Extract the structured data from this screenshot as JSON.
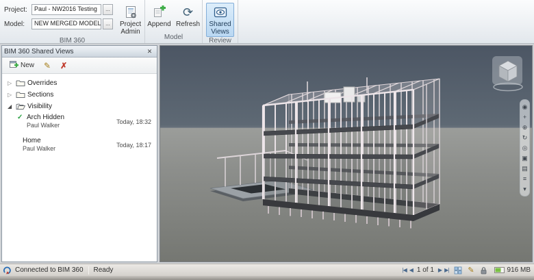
{
  "ribbon": {
    "project": {
      "label": "Project:",
      "value": "Paul - NW2016 Testing"
    },
    "model": {
      "label": "Model:",
      "value": "NEW MERGED MODEL"
    },
    "browse": "...",
    "project_admin": {
      "line1": "Project",
      "line2": "Admin"
    },
    "append_label": "Append",
    "refresh_label": "Refresh",
    "shared_views": {
      "line1": "Shared",
      "line2": "Views"
    },
    "groups": {
      "bim360": "BIM 360",
      "model": "Model",
      "review": "Review"
    }
  },
  "panel": {
    "title": "BIM 360 Shared Views",
    "toolbar": {
      "new_label": "New"
    },
    "tree": {
      "overrides": "Overrides",
      "sections": "Sections",
      "visibility": "Visibility",
      "arch_hidden": {
        "label": "Arch Hidden",
        "author": "Paul Walker",
        "time": "Today, 18:32"
      },
      "home": {
        "label": "Home",
        "author": "Paul Walker",
        "time": "Today, 18:17"
      }
    }
  },
  "statusbar": {
    "connected": "Connected to BIM 360",
    "ready": "Ready",
    "page": "1 of 1",
    "memory": "916 MB"
  },
  "icons": {
    "close": "✕",
    "delete_x": "✗",
    "edit_pencil": "✎",
    "check": "✓",
    "refresh": "⟳",
    "collapsed": "▷",
    "expanded": "◢",
    "first": "|◀",
    "prev": "◀",
    "next": "▶",
    "last": "▶|",
    "nav": [
      "◉",
      "+",
      "⊕",
      "↻",
      "◎",
      "▣",
      "▤",
      "≡",
      "▾"
    ]
  },
  "colors": {
    "accent_selected": "#bcd7f2",
    "sky": "#4c5664",
    "ground": "#8c8e8b",
    "check_green": "#2aa043",
    "delete_red": "#c03a2b"
  }
}
